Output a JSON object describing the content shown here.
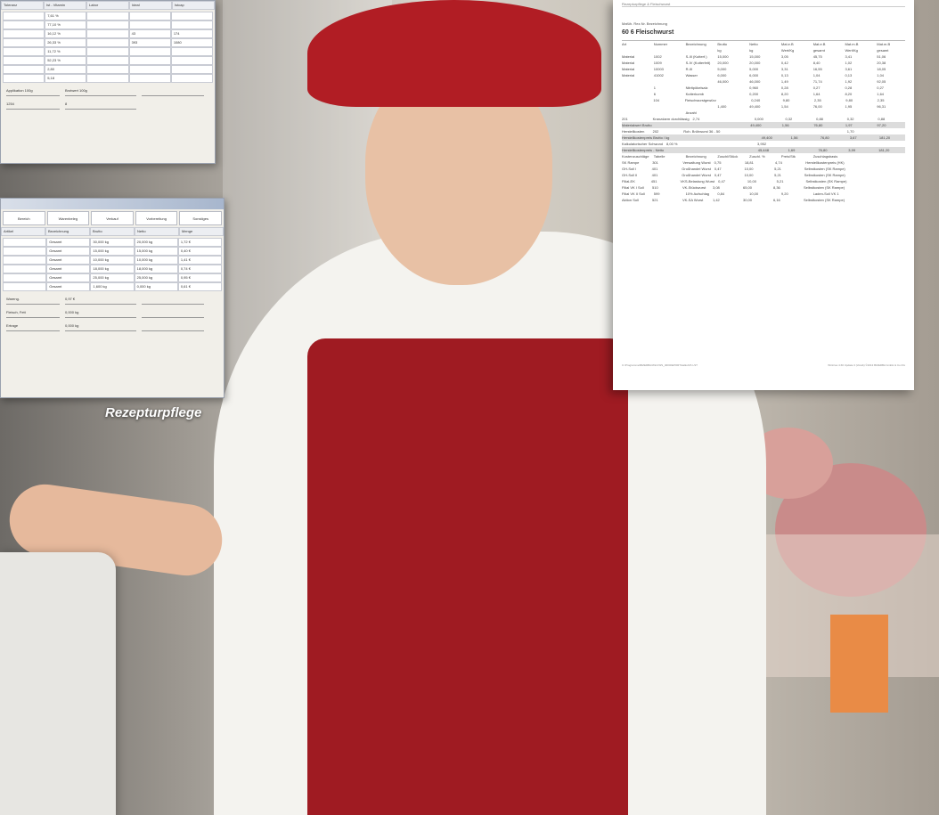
{
  "window1": {
    "headers": [
      "Toleranz",
      "Ist - Vitamin",
      "Labor",
      "Ideal",
      "Istcap"
    ],
    "rows": [
      [
        "",
        "7,61 %",
        "",
        "",
        ""
      ],
      [
        "",
        "77,10 %",
        "",
        "",
        ""
      ],
      [
        "",
        "16,12 %",
        "",
        "43",
        "174"
      ],
      [
        "",
        "26,33 %",
        "",
        "393",
        "1080"
      ],
      [
        "",
        "11,72 %",
        "",
        "",
        ""
      ],
      [
        "",
        "52,23 %",
        "",
        "",
        ""
      ],
      [
        "",
        "2,80",
        "",
        "",
        ""
      ],
      [
        "",
        "5,18",
        "",
        "",
        ""
      ]
    ],
    "field_labels": [
      "Applikation 100g",
      "Brotwert 100g"
    ],
    "field_values": [
      "1254",
      "8"
    ]
  },
  "window2": {
    "tabs": [
      "Bereich",
      "Warenbeleg",
      "Verkauf",
      "Vorbereitung",
      "Sonstiges"
    ],
    "grid_headers": [
      "Artikel",
      "Bezeichnung",
      "Brutto",
      "Netto",
      "Menge"
    ],
    "grid_rows": [
      [
        "",
        "Gesamt",
        "30,000 kg",
        "20,000 kg",
        "1,72 €"
      ],
      [
        "",
        "Gesamt",
        "15,000 kg",
        "15,000 kg",
        "0,40 €"
      ],
      [
        "",
        "Gesamt",
        "10,000 kg",
        "10,000 kg",
        "1,41 €"
      ],
      [
        "",
        "Gesamt",
        "18,000 kg",
        "18,000 kg",
        "0,74 €"
      ],
      [
        "",
        "Gesamt",
        "25,000 kg",
        "25,000 kg",
        "0,95 €"
      ],
      [
        "",
        "Gesamt",
        "1,600 kg",
        "0,000 kg",
        "0,61 €"
      ]
    ],
    "field_labels": [
      "Wareng.",
      "Fleisch, Fett",
      "Ertrage"
    ],
    "field_values": [
      "0,97 €",
      "0,000 kg",
      "0,000 kg"
    ]
  },
  "caption": "Rezepturpflege",
  "report": {
    "top": "Rezepturpflege & Fleischwurst",
    "h1": "Mafüh.    Rez.Nr.    Bezeichnung",
    "h2": "60    6    Fleischwurst",
    "rows": [
      [
        "Art",
        "Nummer",
        "Bezeichnung",
        "Brutto",
        "Netto",
        "Mat.e.B",
        "Mat.e.B",
        "Mat.m.B",
        "Mat.m.B"
      ],
      [
        "",
        "",
        "",
        "kg",
        "kg",
        "Wert/Kg",
        "gesamt",
        "Wert/Kg",
        "gesamt"
      ],
      [
        "Material",
        "1002",
        "S-III (Kutterf.)",
        "15,000",
        "15,000",
        "3,05",
        "45,75",
        "3,41",
        "51,06"
      ],
      [
        "Material",
        "1009",
        "S-IV (Kutterfett)",
        "20,000",
        "20,000",
        "0,42",
        "8,40",
        "1,02",
        "20,38"
      ],
      [
        "Material",
        "10003",
        "R-III",
        "5,000",
        "5,000",
        "3,31",
        "16,55",
        "3,61",
        "18,05"
      ],
      [
        "Material",
        "41002",
        "Wasser",
        "6,000",
        "6,000",
        "0,13",
        "1,04",
        "0,13",
        "1,04"
      ],
      [
        "",
        "",
        "",
        "46,000",
        "46,000",
        "1,49",
        "71,74",
        "1,92",
        "92,05"
      ],
      [
        "",
        "1",
        "Nitritpökelsalz",
        "",
        "0,960",
        "0,28",
        "0,27",
        "0,28",
        "0,27"
      ],
      [
        "",
        "6",
        "Kutterkomb",
        "",
        "0,200",
        "8,20",
        "1,64",
        "8,20",
        "1,64"
      ],
      [
        "",
        "104",
        "Fleischwurstgewürz",
        "",
        "0,240",
        "9,80",
        "2,35",
        "9,80",
        "2,35"
      ],
      [
        "",
        "",
        "",
        "1,400",
        "49,400",
        "1,54",
        "76,00",
        "1,95",
        "96,31"
      ],
      [
        "",
        "",
        "Anzahl",
        "",
        "",
        "",
        "",
        "",
        ""
      ],
      [
        "201",
        "Kranzdarm durchlässig",
        "2,74",
        "",
        "0,000",
        "0,32",
        "0,88",
        "0,32",
        "0,88"
      ],
      [
        "Materialwert Brutto",
        "",
        "",
        "",
        "49,400",
        "1,56",
        "76,80",
        "1,97",
        "97,20"
      ],
      [
        "Herstellkosten",
        "202",
        "Roh. Brühwurst 36 - 50",
        "",
        "",
        "",
        "",
        "1,70",
        ""
      ],
      [
        "Herstellkostenpreis Brutto / kg",
        "",
        "",
        "",
        "49,400",
        "1,56",
        "76,80",
        "3,67",
        "181,20"
      ],
      [
        "Kalkulatorischer Schwund",
        "8,00 %",
        "",
        "",
        "3,952",
        "",
        "",
        "",
        ""
      ],
      [
        "Herstellkostenpreis - Netto",
        "",
        "",
        "",
        "45,448",
        "1,69",
        "76,80",
        "3,99",
        "181,20"
      ],
      [
        "Kostenzuschläge",
        "Tabelle",
        "Bezeichnung",
        "Zuschl/Stück",
        "Zuschl. %",
        "Preis/Stk",
        "Zuschlagsbasis",
        "",
        ""
      ],
      [
        "SK Rampe",
        "301",
        "Verwaltung Wurst",
        "0,75",
        "18,81",
        "4,74",
        "Herstellkostenpreis (HK)",
        "",
        ""
      ],
      [
        "GH-Soll I",
        "401",
        "Großhandel Wurst",
        "0,47",
        "10,00",
        "5,21",
        "Selbstkosten (SK Rampe)",
        "",
        ""
      ],
      [
        "GH-Soll II",
        "401",
        "Großhandel Wurst",
        "0,47",
        "10,00",
        "5,21",
        "Selbstkosten (SK Rampe)",
        "",
        ""
      ],
      [
        "Filial-EK",
        "451",
        "VKS-Belastung Wurst",
        "0,47",
        "10,00",
        "5,21",
        "Selbstkosten (SK Rampe)",
        "",
        ""
      ],
      [
        "Filial VK I Soll",
        "510",
        "VK-Stückwurst",
        "3,08",
        "65,00",
        "8,36",
        "Selbstkosten (SK Rampe)",
        "",
        ""
      ],
      [
        "Filial VK II Soll",
        "599",
        "10% Aufschlag",
        "0,84",
        "10,00",
        "9,20",
        "Laden-Soll VK 1",
        "",
        ""
      ],
      [
        "Aktion Soll",
        "521",
        "VK-SA Wurst",
        "1,42",
        "30,00",
        "6,16",
        "Selbstkosten (SK Rampe)",
        "",
        ""
      ]
    ],
    "shaded_rows": [
      13,
      15,
      17
    ],
    "footer_left": "C:\\Programme\\BIZERBA\\WinCWS_460\\REPORT\\kalkulVK.LST",
    "footer_right": "WinCws 4.60 Update 3 (Vorab) ©2013 BIZERBA GmbH & Co.KG"
  }
}
